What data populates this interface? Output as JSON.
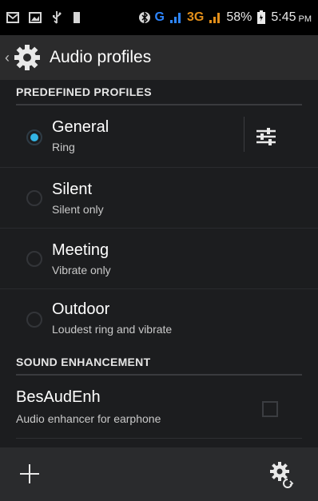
{
  "status_bar": {
    "net_g": "G",
    "net_3g": "3G",
    "battery_percent": "58%",
    "time": "5:45",
    "time_suffix": "PM"
  },
  "action_bar": {
    "title": "Audio profiles"
  },
  "sections": {
    "predefined_header": "PREDEFINED PROFILES",
    "sound_header": "SOUND ENHANCEMENT"
  },
  "profiles": [
    {
      "name": "General",
      "subtitle": "Ring",
      "selected": true
    },
    {
      "name": "Silent",
      "subtitle": "Silent only",
      "selected": false
    },
    {
      "name": "Meeting",
      "subtitle": "Vibrate only",
      "selected": false
    },
    {
      "name": "Outdoor",
      "subtitle": "Loudest ring and vibrate",
      "selected": false
    }
  ],
  "enhancement": {
    "name": "BesAudEnh",
    "subtitle": "Audio enhancer for earphone",
    "checked": false
  },
  "colors": {
    "accent": "#33b5e5",
    "background": "#1c1d1f",
    "action_bar": "#2b2b2c",
    "bottom_bar": "#2a2b2d"
  },
  "icons": {
    "app": "audio-settings-gear-icon",
    "profile_settings": "sliders-icon",
    "add": "add-icon",
    "settings": "settings-reset-icon"
  }
}
